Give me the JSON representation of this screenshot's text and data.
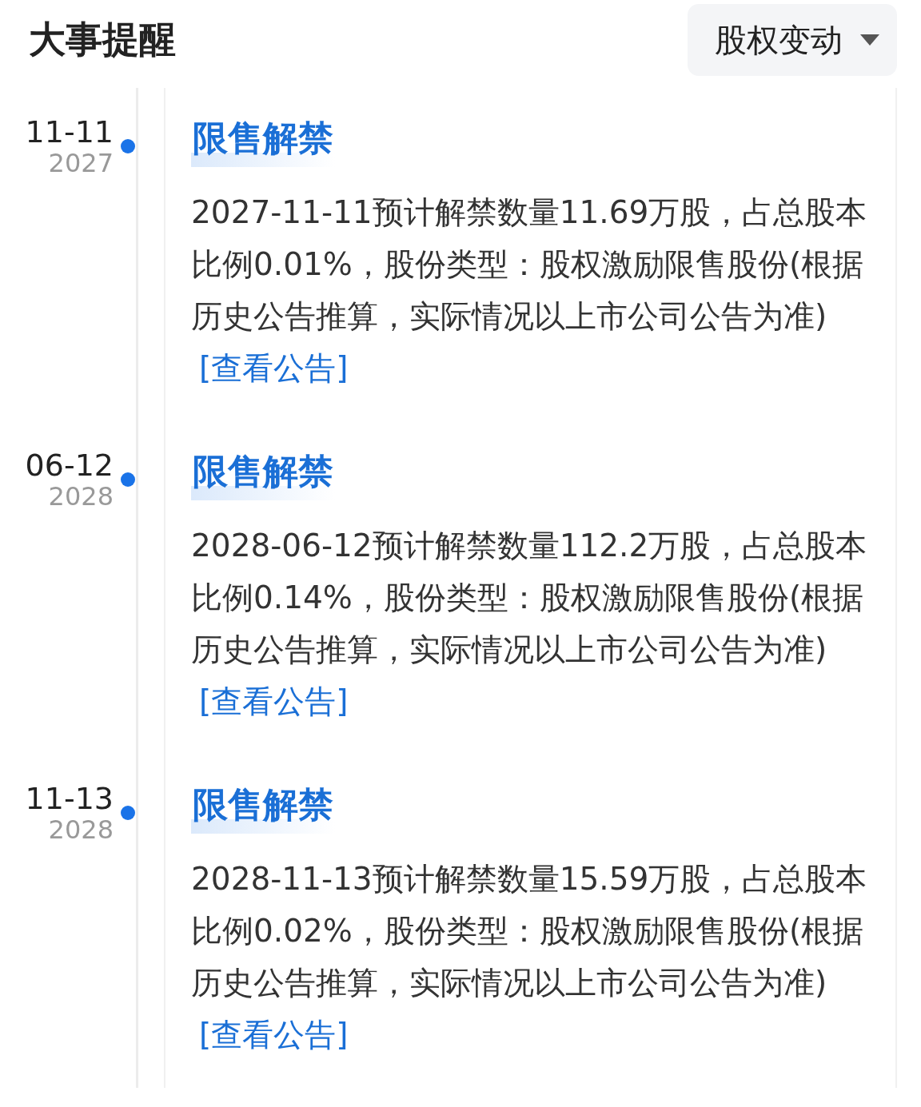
{
  "header": {
    "title": "大事提醒",
    "filter": {
      "label": "股权变动"
    }
  },
  "events": [
    {
      "date": "11-11",
      "year": "2027",
      "title": "限售解禁",
      "body": "2027-11-11预计解禁数量11.69万股，占总股本比例0.01%，股份类型：股权激励限售股份(根据历史公告推算，实际情况以上市公司公告为准)",
      "link": "[查看公告]"
    },
    {
      "date": "06-12",
      "year": "2028",
      "title": "限售解禁",
      "body": "2028-06-12预计解禁数量112.2万股，占总股本比例0.14%，股份类型：股权激励限售股份(根据历史公告推算，实际情况以上市公司公告为准)",
      "link": "[查看公告]"
    },
    {
      "date": "11-13",
      "year": "2028",
      "title": "限售解禁",
      "body": "2028-11-13预计解禁数量15.59万股，占总股本比例0.02%，股份类型：股权激励限售股份(根据历史公告推算，实际情况以上市公司公告为准)",
      "link": "[查看公告]"
    }
  ]
}
